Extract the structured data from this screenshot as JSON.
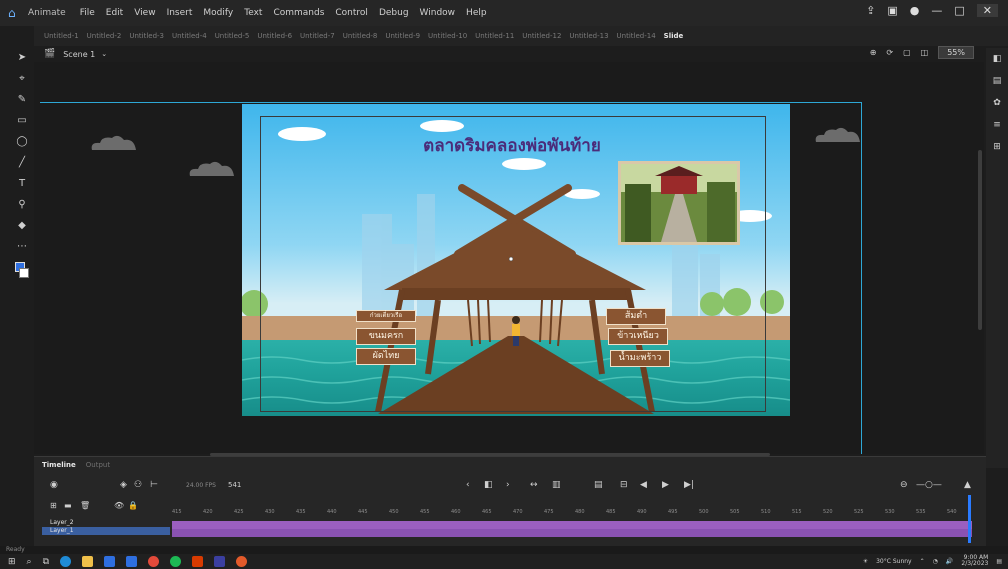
{
  "menubar": {
    "app_name": "Animate",
    "items": [
      "File",
      "Edit",
      "View",
      "Insert",
      "Modify",
      "Text",
      "Commands",
      "Control",
      "Debug",
      "Window",
      "Help"
    ]
  },
  "tabs": [
    "Untitled-1",
    "Untitled-2",
    "Untitled-3",
    "Untitled-4",
    "Untitled-5",
    "Untitled-6",
    "Untitled-7",
    "Untitled-8",
    "Untitled-9",
    "Untitled-10",
    "Untitled-11",
    "Untitled-12",
    "Untitled-13",
    "Untitled-14",
    "Slide"
  ],
  "editbar": {
    "scene_label": "Scene 1",
    "zoom": "55%"
  },
  "stage": {
    "title": "ตลาดริมคลองพ่อพันท้าย",
    "signs_left": [
      "ก๋วยเตี๋ยวเรือ",
      "ขนมครก",
      "ผัดไทย"
    ],
    "signs_right": [
      "ส้มตำ",
      "ข้าวเหนียว",
      "น้ำมะพร้าว"
    ]
  },
  "timeline": {
    "tab_active": "Timeline",
    "tab_inactive": "Output",
    "fps": "24.00 FPS",
    "frame": "541",
    "layers": [
      "Layer_2",
      "Layer_1"
    ],
    "ruler_ticks": [
      "415",
      "420",
      "425",
      "430",
      "435",
      "440",
      "445",
      "450",
      "455",
      "460",
      "465",
      "470",
      "475",
      "480",
      "485",
      "490",
      "495",
      "500",
      "505",
      "510",
      "515",
      "520",
      "525",
      "530",
      "535",
      "540"
    ]
  },
  "status": "Ready",
  "taskbar": {
    "weather": "30°C Sunny",
    "time": "9:00 AM",
    "date": "2/3/2023"
  }
}
